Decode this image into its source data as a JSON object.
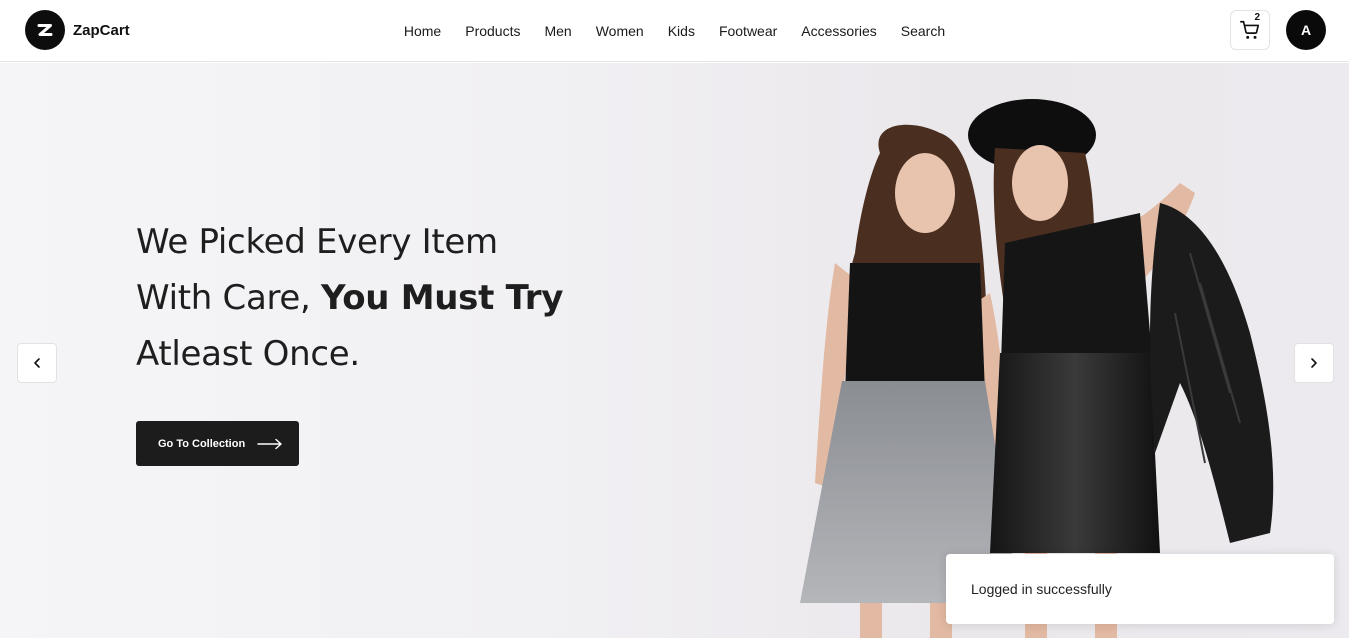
{
  "brand": {
    "name": "ZapCart",
    "logo_icon": "z-logo-icon"
  },
  "nav": {
    "items": [
      {
        "label": "Home"
      },
      {
        "label": "Products"
      },
      {
        "label": "Men"
      },
      {
        "label": "Women"
      },
      {
        "label": "Kids"
      },
      {
        "label": "Footwear"
      },
      {
        "label": "Accessories"
      },
      {
        "label": "Search"
      }
    ]
  },
  "cart": {
    "icon": "cart-icon",
    "count": "2"
  },
  "user": {
    "avatar_initial": "A"
  },
  "hero": {
    "line1": "We Picked Every Item",
    "line2_regular": "With Care, ",
    "line2_bold": "You Must Try",
    "line3": "Atleast Once.",
    "cta_label": "Go To Collection",
    "cta_icon": "arrow-right-icon",
    "prev_icon": "chevron-left-icon",
    "next_icon": "chevron-right-icon"
  },
  "toast": {
    "message": "Logged in successfully"
  },
  "colors": {
    "accent": "#1c1c1c",
    "background": "#f2f1f4",
    "navbar": "#ffffff"
  }
}
